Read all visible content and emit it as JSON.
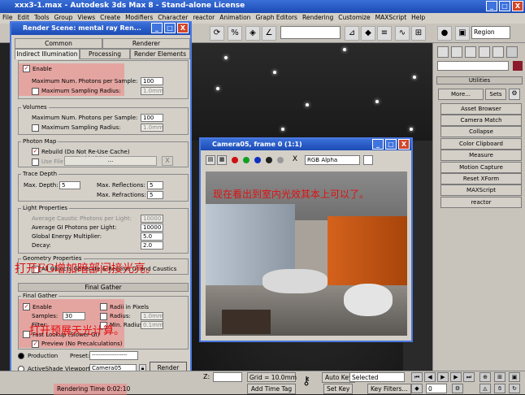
{
  "app": {
    "title": "xxx3-1.max - Autodesk 3ds Max 8 - Stand-alone License",
    "min": "_",
    "max": "□",
    "close": "X",
    "menus": [
      "File",
      "Edit",
      "Tools",
      "Group",
      "Views",
      "Create",
      "Modifiers",
      "Character",
      "reactor",
      "Animation",
      "Graph Editors",
      "Rendering",
      "Customize",
      "MAXScript",
      "Help"
    ]
  },
  "toolbar": {
    "selection_set": "Region"
  },
  "right_panel": {
    "heading": "Utilities",
    "more_label": "More...",
    "sets_label": "Sets",
    "buttons": [
      "Asset Browser",
      "Camera Match",
      "Collapse",
      "Color Clipboard",
      "Measure",
      "Motion Capture",
      "Reset XForm",
      "MAXScript",
      "reactor"
    ]
  },
  "render_scene": {
    "title": "Render Scene: mental ray Ren...",
    "tabs_top": [
      "Common",
      "Renderer"
    ],
    "tabs_bottom": [
      "Indirect Illumination",
      "Processing",
      "Render Elements"
    ],
    "caustics": {
      "enable": "Enable",
      "max_photons_label": "Maximum Num. Photons per Sample:",
      "max_photons_value": "100",
      "max_radius_label": "Maximum Sampling Radius:",
      "max_radius_value": "1.0mm"
    },
    "volumes": {
      "header": "Volumes",
      "max_photons_label": "Maximum Num. Photons per Sample:",
      "max_photons_value": "100",
      "max_radius_label": "Maximum Sampling Radius:",
      "max_radius_value": "1.0mm"
    },
    "photon_map": {
      "header": "Photon Map",
      "rebuild": "Rebuild (Do Not Re-Use Cache)",
      "use_file": "Use File",
      "file_btn": "...",
      "clear_btn": "X"
    },
    "trace_depth": {
      "header": "Trace Depth",
      "max_depth_label": "Max. Depth:",
      "max_depth_value": "5",
      "max_reflections_label": "Max. Reflections:",
      "max_reflections_value": "5",
      "max_refractions_label": "Max. Refractions:",
      "max_refractions_value": "5"
    },
    "light_properties": {
      "header": "Light Properties",
      "avg_caustic_label": "Average Caustic Photons per Light:",
      "avg_caustic_value": "10000",
      "avg_gi_label": "Average GI Photons per Light:",
      "avg_gi_value": "10000",
      "global_energy_label": "Global Energy Multiplier:",
      "global_energy_value": "5.0",
      "decay_label": "Decay:",
      "decay_value": "2.0"
    },
    "geometry_properties": {
      "header": "Geometry Properties",
      "all_objects": "All Objects Generate & Receive GI and Caustics"
    },
    "final_gather_rollout": "Final Gather",
    "final_gather": {
      "header": "Final Gather",
      "enable": "Enable",
      "radii_in_pixels": "Radii in Pixels",
      "samples_label": "Samples:",
      "samples_value": "30",
      "radius_label": "Radius:",
      "radius_value": "1.0mm",
      "filter_label": "Filter:",
      "min_radius_label": "Min. Radius:",
      "min_radius_value": "0.1mm",
      "fast_lookup": "Fast Lookup (Slower GI)",
      "preview": "Preview (No Precalculations)"
    },
    "bottom": {
      "production": "Production",
      "activeshade": "ActiveShade",
      "preset_label": "Preset:",
      "preset_value": "--------------------",
      "viewport_label": "Viewport:",
      "viewport_value": "Camera05",
      "render_btn": "Render"
    }
  },
  "camera_window": {
    "title": "Camera05, frame 0 (1:1)",
    "channel": "RGB Alpha",
    "clear_btn": "X"
  },
  "overlays": {
    "watermark": "一水阳光",
    "caption_top": "现在看出到室内光效其本上可以了。",
    "caption_mid": "打开FG增加暗部间接光亮。",
    "caption_bottom": "打开预展天光计算。"
  },
  "statusbar": {
    "z_label": "Z:",
    "grid": "Grid = 10.0mm",
    "add_time_tag": "Add Time Tag",
    "auto_key": "Auto Key",
    "set_key": "Set Key",
    "selected": "Selected",
    "key_filters": "Key Filters...",
    "rendering_time": "Rendering Time  0:02:10",
    "frame": "0"
  }
}
